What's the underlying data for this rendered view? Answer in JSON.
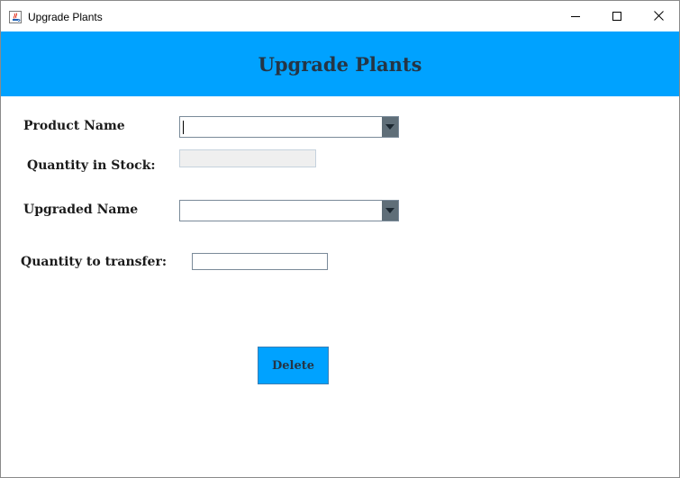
{
  "window": {
    "title": "Upgrade Plants",
    "icon": "java-cup-icon"
  },
  "header": {
    "title": "Upgrade Plants",
    "background": "#00a2ff",
    "text_color": "#253545"
  },
  "form": {
    "product_name": {
      "label": "Product Name",
      "selected_value": ""
    },
    "quantity_in_stock": {
      "label": "Quantity in Stock:",
      "value": ""
    },
    "upgraded_name": {
      "label": "Upgraded Name",
      "selected_value": ""
    },
    "quantity_to_transfer": {
      "label": "Quantity to transfer:",
      "value": ""
    }
  },
  "actions": {
    "delete_label": "Delete"
  }
}
